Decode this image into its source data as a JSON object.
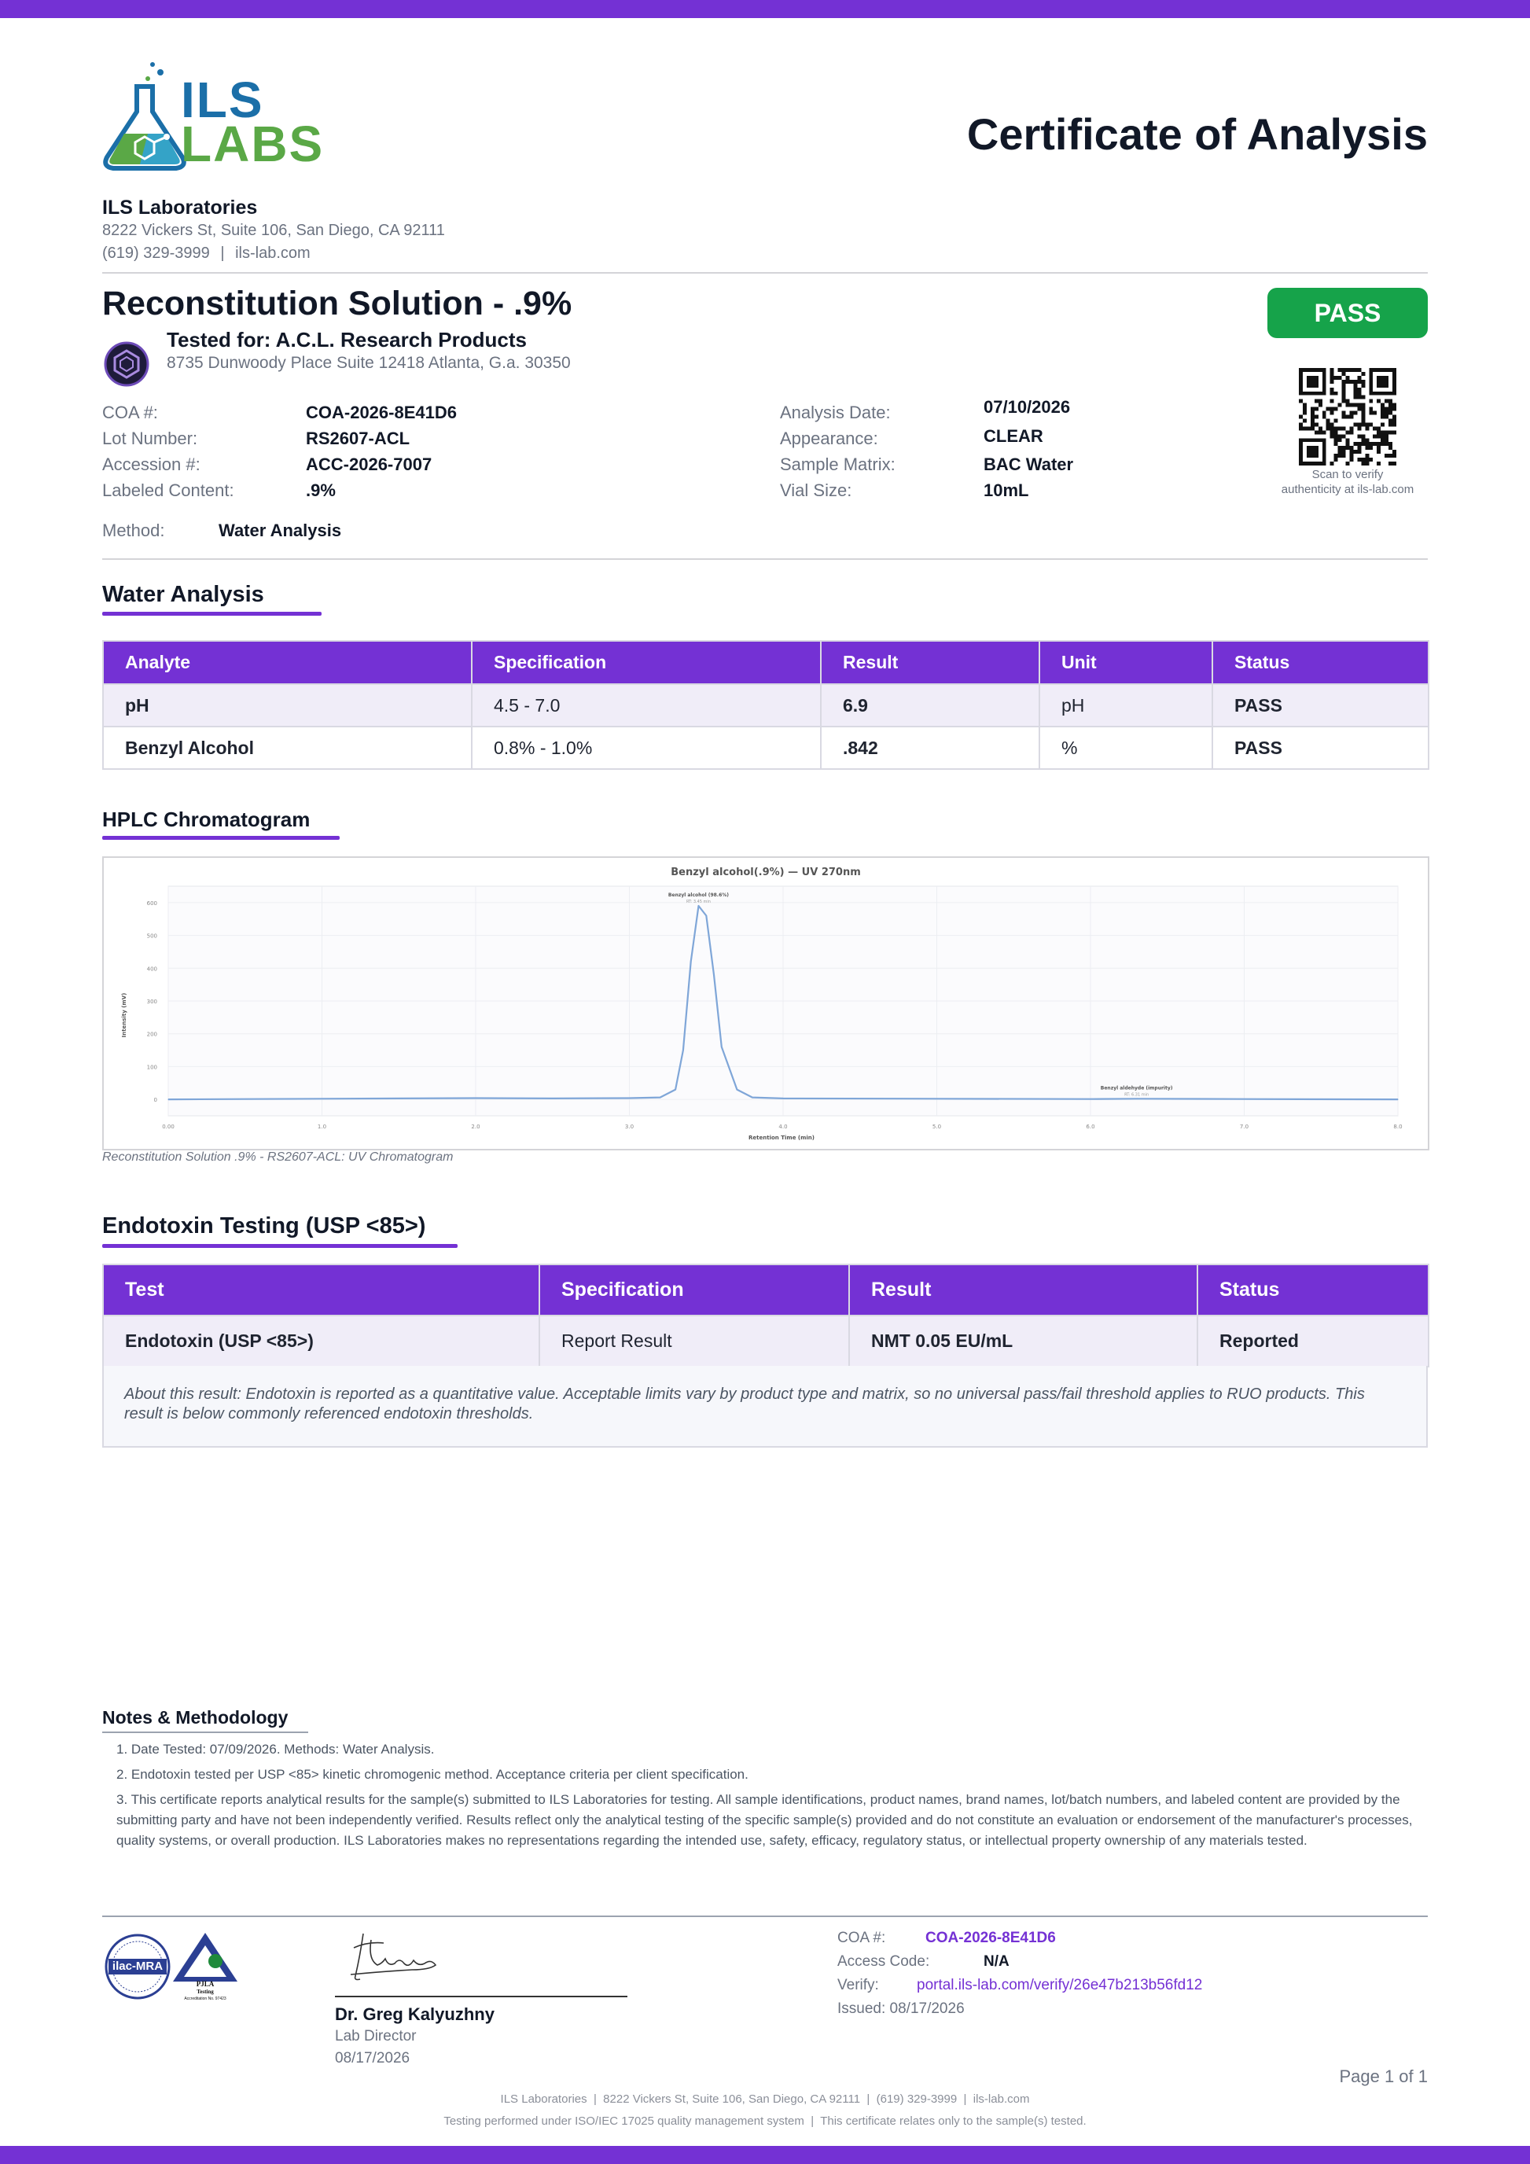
{
  "header": {
    "logo_text_top": "ILS",
    "logo_text_bottom": "LABS",
    "doc_title": "Certificate of Analysis",
    "lab_name": "ILS Laboratories",
    "lab_address": "8222 Vickers St, Suite 106, San Diego, CA 92111",
    "lab_phone": "(619) 329-3999",
    "lab_site": "ils-lab.com",
    "sep": "|"
  },
  "product": {
    "title": "Reconstitution Solution - .9%",
    "tested_for": "Tested for: A.C.L. Research Products",
    "client_address": "8735 Dunwoody Place Suite 12418 Atlanta, G.a. 30350",
    "status_badge": "PASS",
    "qr_caption_1": "Scan to verify",
    "qr_caption_2": "authenticity at ils-lab.com"
  },
  "details_left": [
    {
      "label": "COA #:",
      "value": "COA-2026-8E41D6"
    },
    {
      "label": "Lot Number:",
      "value": "RS2607-ACL"
    },
    {
      "label": "Accession #:",
      "value": "ACC-2026-7007"
    },
    {
      "label": "Labeled Content:",
      "value": ".9%"
    }
  ],
  "details_right": [
    {
      "label": "Analysis Date:",
      "value": "07/10/2026"
    },
    {
      "label": "Appearance:",
      "value": "CLEAR"
    },
    {
      "label": "Sample Matrix:",
      "value": "BAC Water"
    },
    {
      "label": "Vial Size:",
      "value": "10mL"
    }
  ],
  "method": {
    "label": "Method:",
    "value": "Water Analysis"
  },
  "water_analysis": {
    "title": "Water Analysis",
    "headers": [
      "Analyte",
      "Specification",
      "Result",
      "Unit",
      "Status"
    ],
    "rows": [
      [
        "pH",
        "4.5 - 7.0",
        "6.9",
        "pH",
        "PASS"
      ],
      [
        "Benzyl Alcohol",
        "0.8% - 1.0%",
        ".842",
        "%",
        "PASS"
      ]
    ]
  },
  "hplc": {
    "title": "HPLC Chromatogram",
    "caption": "Reconstitution Solution .9% - RS2607-ACL: UV Chromatogram"
  },
  "chart_data": {
    "type": "line",
    "title": "Benzyl alcohol(.9%) — UV 270nm",
    "xlabel": "Retention Time (min)",
    "ylabel": "Intensity (mV)",
    "xlim": [
      0,
      8
    ],
    "ylim": [
      -50,
      650
    ],
    "x_ticks": [
      "0.00",
      "1.0",
      "2.0",
      "3.0",
      "4.0",
      "5.0",
      "6.0",
      "7.0",
      "8.0"
    ],
    "y_ticks": [
      "0",
      "100",
      "200",
      "300",
      "400",
      "500",
      "600"
    ],
    "series": [
      {
        "x": [
          0.0,
          0.5,
          1.0,
          1.5,
          2.0,
          2.5,
          3.0,
          3.2,
          3.3,
          3.35,
          3.4,
          3.45,
          3.5,
          3.55,
          3.6,
          3.7,
          3.8,
          4.0,
          5.0,
          6.0,
          6.3,
          7.0,
          8.0
        ],
        "y": [
          0,
          1,
          2,
          3,
          4,
          3,
          4,
          6,
          30,
          150,
          420,
          590,
          560,
          380,
          160,
          30,
          6,
          3,
          2,
          1,
          2,
          1,
          0
        ]
      }
    ],
    "annotations": [
      {
        "x": 3.45,
        "y": 590,
        "text": "Benzyl alcohol (98.6%)",
        "sub": "RT: 3.45 min"
      },
      {
        "x": 6.3,
        "y": 2,
        "text": "Benzyl aldehyde (impurity)",
        "sub": "RT: 6.31 min"
      }
    ],
    "legend_text": "270nm",
    "grid": true
  },
  "endotoxin": {
    "title": "Endotoxin Testing (USP <85>)",
    "headers": [
      "Test",
      "Specification",
      "Result",
      "Status"
    ],
    "rows": [
      [
        "Endotoxin (USP <85>)",
        "Report Result",
        "NMT 0.05 EU/mL",
        "Reported"
      ]
    ],
    "note": "About this result: Endotoxin is reported as a quantitative value. Acceptable limits vary by product type and matrix, so no universal pass/fail threshold applies to RUO products. This result is below commonly referenced endotoxin thresholds."
  },
  "notes": {
    "title": "Notes & Methodology",
    "items": [
      "1. Date Tested: 07/09/2026. Methods: Water Analysis.",
      "2. Endotoxin tested per USP <85> kinetic chromogenic method. Acceptance criteria per client specification.",
      "3. This certificate reports analytical results for the sample(s) submitted to ILS Laboratories for testing. All sample identifications, product names, brand names, lot/batch numbers, and labeled content are provided by the submitting party and have not been independently verified. Results reflect only the analytical testing of the specific sample(s) provided and do not constitute an evaluation or endorsement of the manufacturer's processes, quality systems, or overall production. ILS Laboratories makes no representations regarding the intended use, safety, efficacy, regulatory status, or intellectual property ownership of any materials tested."
    ]
  },
  "accreditation": {
    "ilac_text": "ilac-MRA",
    "pjla_text": "PJLA",
    "pjla_sub": "Testing",
    "pjla_acc": "Accreditation No. 97423"
  },
  "signature": {
    "name": "Dr. Greg Kalyuzhny",
    "role": "Lab Director",
    "date": "08/17/2026"
  },
  "verify": {
    "coa_label": "COA #:",
    "coa_value": "COA-2026-8E41D6",
    "access_label": "Access Code:",
    "access_value": "N/A",
    "verify_label": "Verify:",
    "verify_value": "portal.ils-lab.com/verify/26e47b213b56fd12",
    "issued": "Issued: 08/17/2026"
  },
  "footer": {
    "page": "Page 1 of 1",
    "line1": "ILS Laboratories  |  8222 Vickers St, Suite 106, San Diego, CA 92111  |  (619) 329-3999  |  ils-lab.com",
    "line2": "Testing performed under ISO/IEC 17025 quality management system  |  This certificate relates only to the sample(s) tested."
  },
  "colors": {
    "accent": "#7431d4",
    "pass": "#16a34a",
    "logo_blue": "#1b6fa8",
    "logo_green": "#5aa846",
    "chart_line": "#7fa6d8"
  }
}
